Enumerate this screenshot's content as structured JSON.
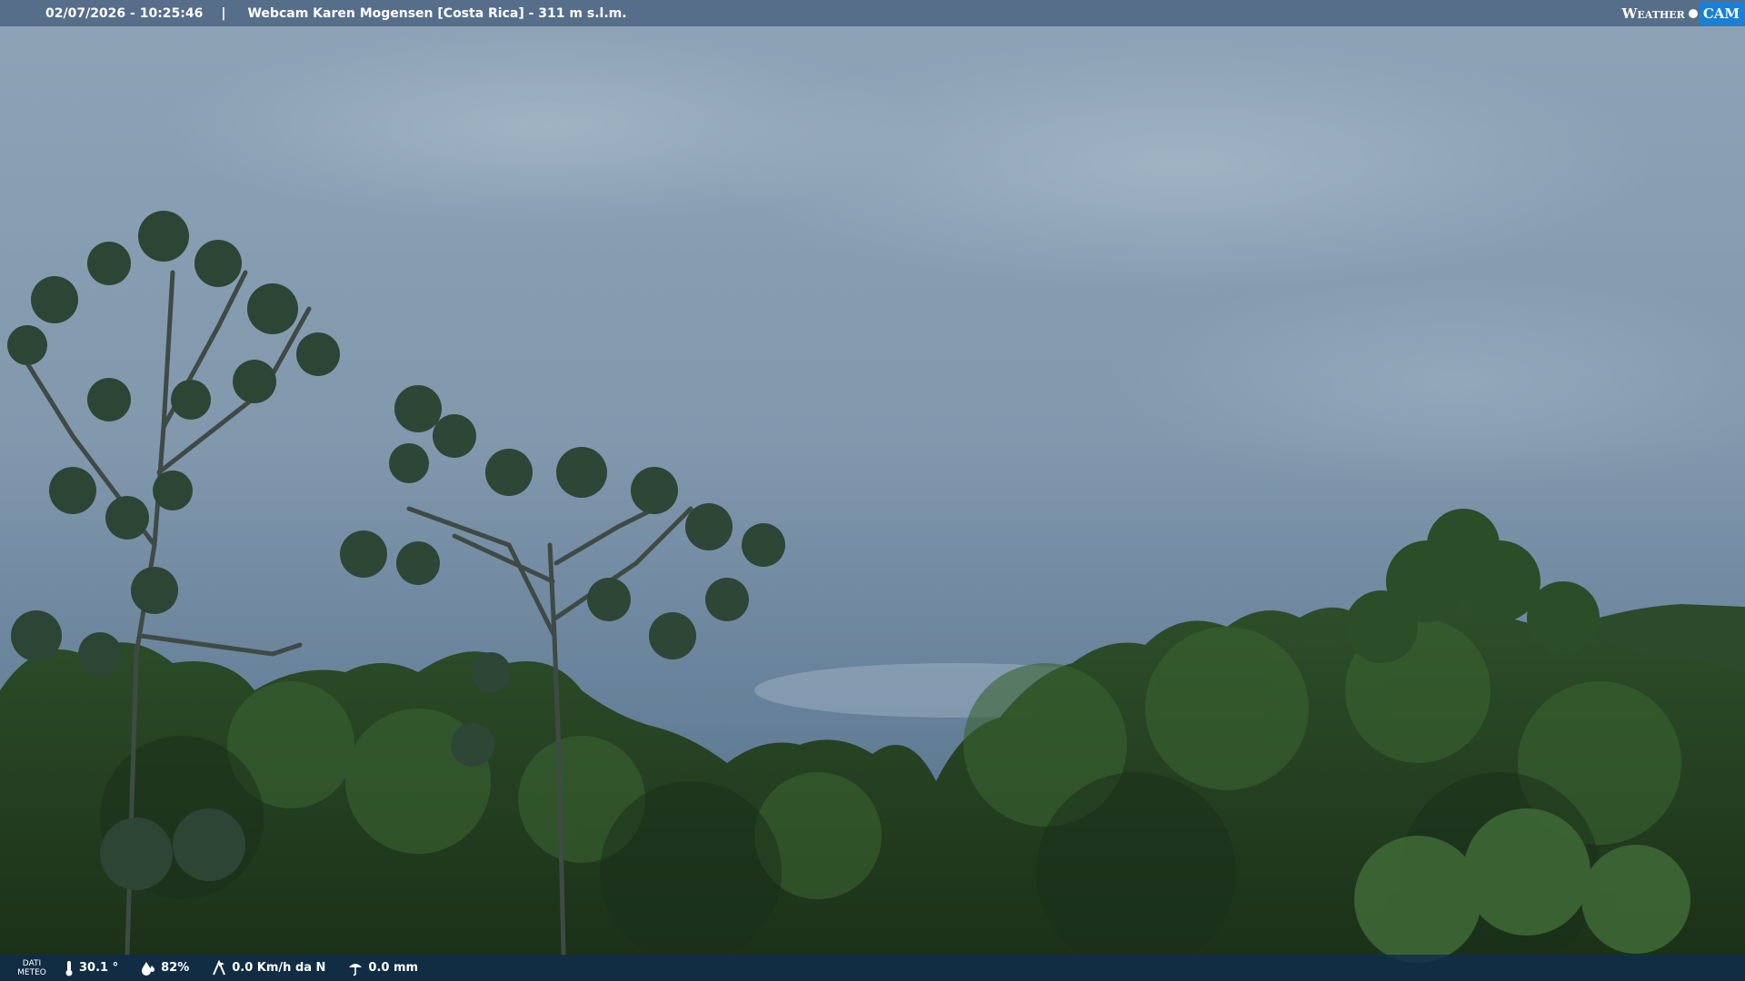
{
  "header": {
    "timestamp": "02/07/2026 - 10:25:46",
    "separator": "|",
    "location": "Webcam Karen Mogensen [Costa Rica]  - 311 m s.l.m."
  },
  "logo": {
    "word": "Weather",
    "cam": "CAM"
  },
  "footer": {
    "label_line1": "DATI",
    "label_line2": "METEO",
    "temperature": "30.1 °",
    "humidity": "82%",
    "wind": "0.0 Km/h da N",
    "rain": "0.0 mm",
    "icons": [
      "thermometer-icon",
      "humidity-icon",
      "wind-icon",
      "rain-icon"
    ]
  },
  "colors": {
    "sky_top": "#8fa6b9",
    "sky_bottom": "#5d7891",
    "forest_dark": "#1f3a1c",
    "forest_mid": "#2f5327",
    "accent_blue": "#1a7fd6"
  }
}
